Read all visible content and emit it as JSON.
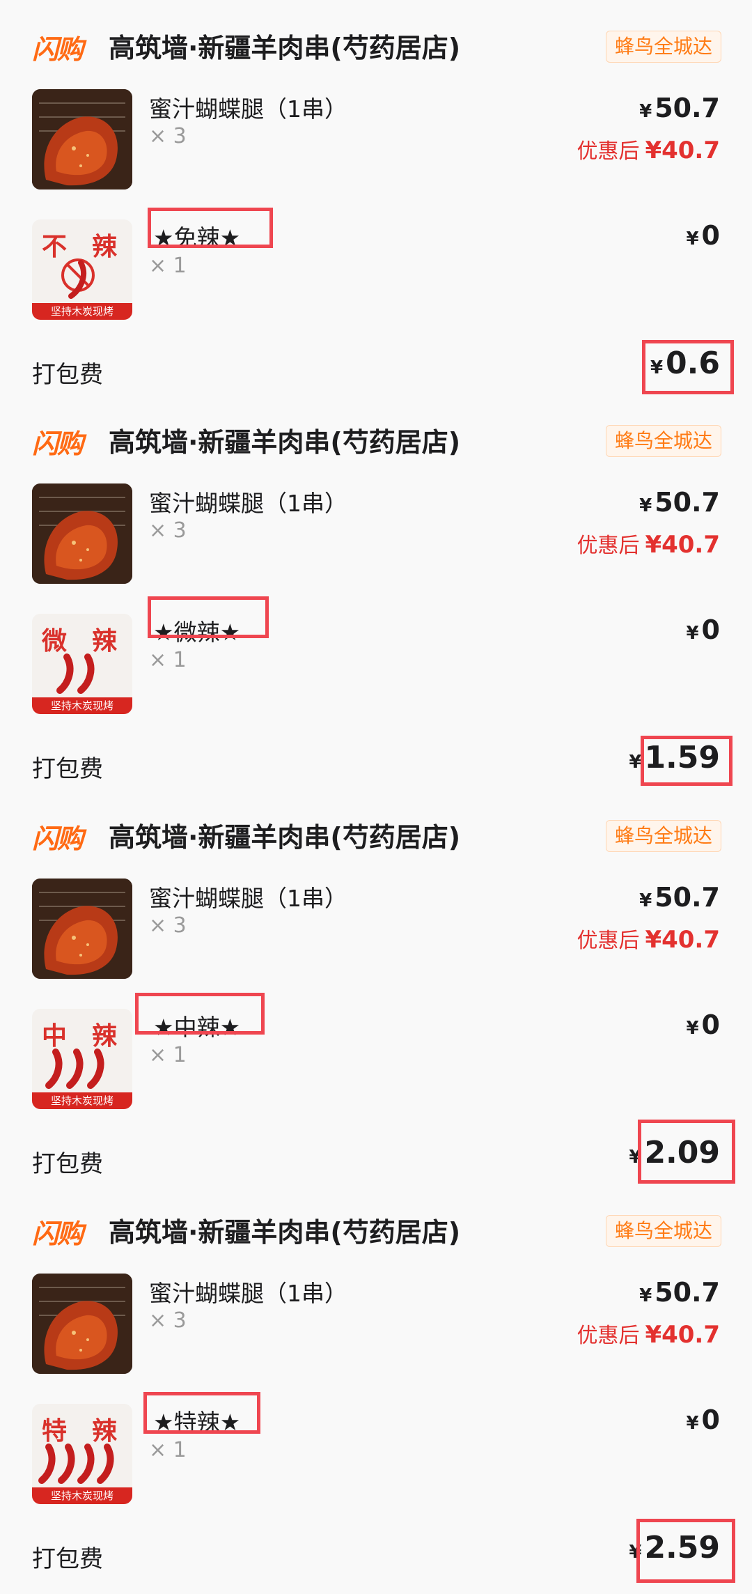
{
  "orders": [
    {
      "shop": {
        "logo": "闪购",
        "name": "高筑墙·新疆羊肉串(芍药居店)",
        "badge": "蜂鸟全城达"
      },
      "item": {
        "title": "蜜汁蝴蝶腿（1串）",
        "qty": "× 3",
        "price": "50.7",
        "discount_label": "优惠后",
        "discount_price": "¥40.7"
      },
      "spice": {
        "name": "★免辣★",
        "qty": "× 1",
        "price": "0",
        "thumb_text_1": "不",
        "thumb_text_2": "辣",
        "thumb_banner": "坚持木炭现烤",
        "chili_count": 1
      },
      "packing": {
        "label": "打包费",
        "fee": "0.6"
      }
    },
    {
      "shop": {
        "logo": "闪购",
        "name": "高筑墙·新疆羊肉串(芍药居店)",
        "badge": "蜂鸟全城达"
      },
      "item": {
        "title": "蜜汁蝴蝶腿（1串）",
        "qty": "× 3",
        "price": "50.7",
        "discount_label": "优惠后",
        "discount_price": "¥40.7"
      },
      "spice": {
        "name": "★微辣★",
        "qty": "× 1",
        "price": "0",
        "thumb_text_1": "微",
        "thumb_text_2": "辣",
        "thumb_banner": "坚持木炭现烤",
        "chili_count": 2
      },
      "packing": {
        "label": "打包费",
        "fee": "1.59"
      }
    },
    {
      "shop": {
        "logo": "闪购",
        "name": "高筑墙·新疆羊肉串(芍药居店)",
        "badge": "蜂鸟全城达"
      },
      "item": {
        "title": "蜜汁蝴蝶腿（1串）",
        "qty": "× 3",
        "price": "50.7",
        "discount_label": "优惠后",
        "discount_price": "¥40.7"
      },
      "spice": {
        "name": "★中辣★",
        "qty": "× 1",
        "price": "0",
        "thumb_text_1": "中",
        "thumb_text_2": "辣",
        "thumb_banner": "坚持木炭现烤",
        "chili_count": 3
      },
      "packing": {
        "label": "打包费",
        "fee": "2.09"
      }
    },
    {
      "shop": {
        "logo": "闪购",
        "name": "高筑墙·新疆羊肉串(芍药居店)",
        "badge": "蜂鸟全城达"
      },
      "item": {
        "title": "蜜汁蝴蝶腿（1串）",
        "qty": "× 3",
        "price": "50.7",
        "discount_label": "优惠后",
        "discount_price": "¥40.7"
      },
      "spice": {
        "name": "★特辣★",
        "qty": "× 1",
        "price": "0",
        "thumb_text_1": "特",
        "thumb_text_2": "辣",
        "thumb_banner": "坚持木炭现烤",
        "chili_count": 4
      },
      "packing": {
        "label": "打包费",
        "fee": "2.59"
      }
    }
  ],
  "currency_symbol": "¥",
  "colors": {
    "accent": "#ff6a14",
    "discount": "#e3312f",
    "highlight": "#ef4650"
  }
}
